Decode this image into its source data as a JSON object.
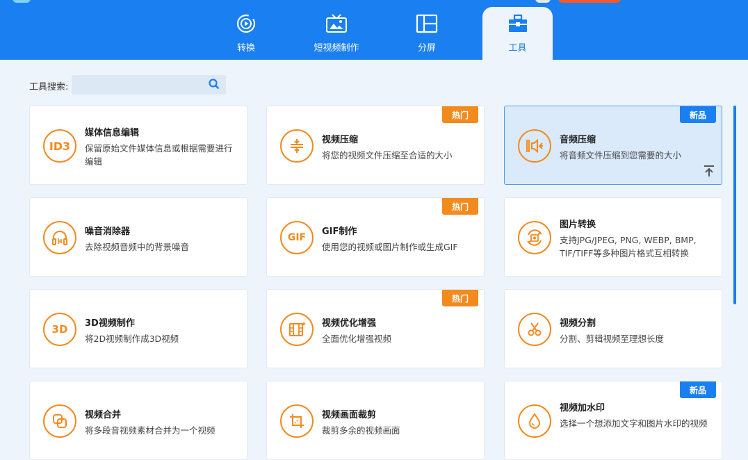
{
  "tabs": [
    {
      "label": "转换",
      "icon": "convert-icon"
    },
    {
      "label": "短视频制作",
      "icon": "tv-image-icon"
    },
    {
      "label": "分屏",
      "icon": "split-screen-icon"
    },
    {
      "label": "工具",
      "icon": "toolbox-icon"
    }
  ],
  "search": {
    "label": "工具搜索:",
    "value": "",
    "placeholder": ""
  },
  "tools": [
    {
      "title": "媒体信息编辑",
      "desc": "保留原始文件媒体信息或根据需要进行编辑",
      "icon_text": "ID3",
      "icon": "id3-icon",
      "badge": ""
    },
    {
      "title": "视频压缩",
      "desc": "将您的视频文件压缩至合适的大小",
      "icon_text": "",
      "icon": "compress-icon",
      "badge": "热门"
    },
    {
      "title": "音频压缩",
      "desc": "将音频文件压缩到您需要的大小",
      "icon_text": "",
      "icon": "audio-compress-icon",
      "badge": "新品"
    },
    {
      "title": "噪音消除器",
      "desc": "去除视频音频中的背景噪音",
      "icon_text": "",
      "icon": "headphone-icon",
      "badge": ""
    },
    {
      "title": "GIF制作",
      "desc": "使用您的视频或图片制作或生成GIF",
      "icon_text": "GIF",
      "icon": "gif-icon",
      "badge": "热门"
    },
    {
      "title": "图片转换",
      "desc": "支持JPG/JPEG, PNG, WEBP, BMP, TIF/TIFF等多种图片格式互相转换",
      "icon_text": "",
      "icon": "image-convert-icon",
      "badge": ""
    },
    {
      "title": "3D视频制作",
      "desc": "将2D视频制作成3D视频",
      "icon_text": "3D",
      "icon": "3d-icon",
      "badge": ""
    },
    {
      "title": "视频优化增强",
      "desc": "全面优化增强视频",
      "icon_text": "",
      "icon": "film-enhance-icon",
      "badge": "热门"
    },
    {
      "title": "视频分割",
      "desc": "分割、剪辑视频至理想长度",
      "icon_text": "",
      "icon": "scissors-icon",
      "badge": ""
    },
    {
      "title": "视频合并",
      "desc": "将多段音视频素材合并为一个视频",
      "icon_text": "",
      "icon": "merge-icon",
      "badge": ""
    },
    {
      "title": "视频画面裁剪",
      "desc": "裁剪多余的视频画面",
      "icon_text": "",
      "icon": "crop-icon",
      "badge": ""
    },
    {
      "title": "视频加水印",
      "desc": "选择一个想添加文字和图片水印的视频",
      "icon_text": "",
      "icon": "watermark-drop-icon",
      "badge": "新品"
    }
  ],
  "colors": {
    "primary": "#1a7ff0",
    "accent": "#f28a1e",
    "hot_badge": "#f28a1e",
    "new_badge": "#1a7ff0"
  }
}
